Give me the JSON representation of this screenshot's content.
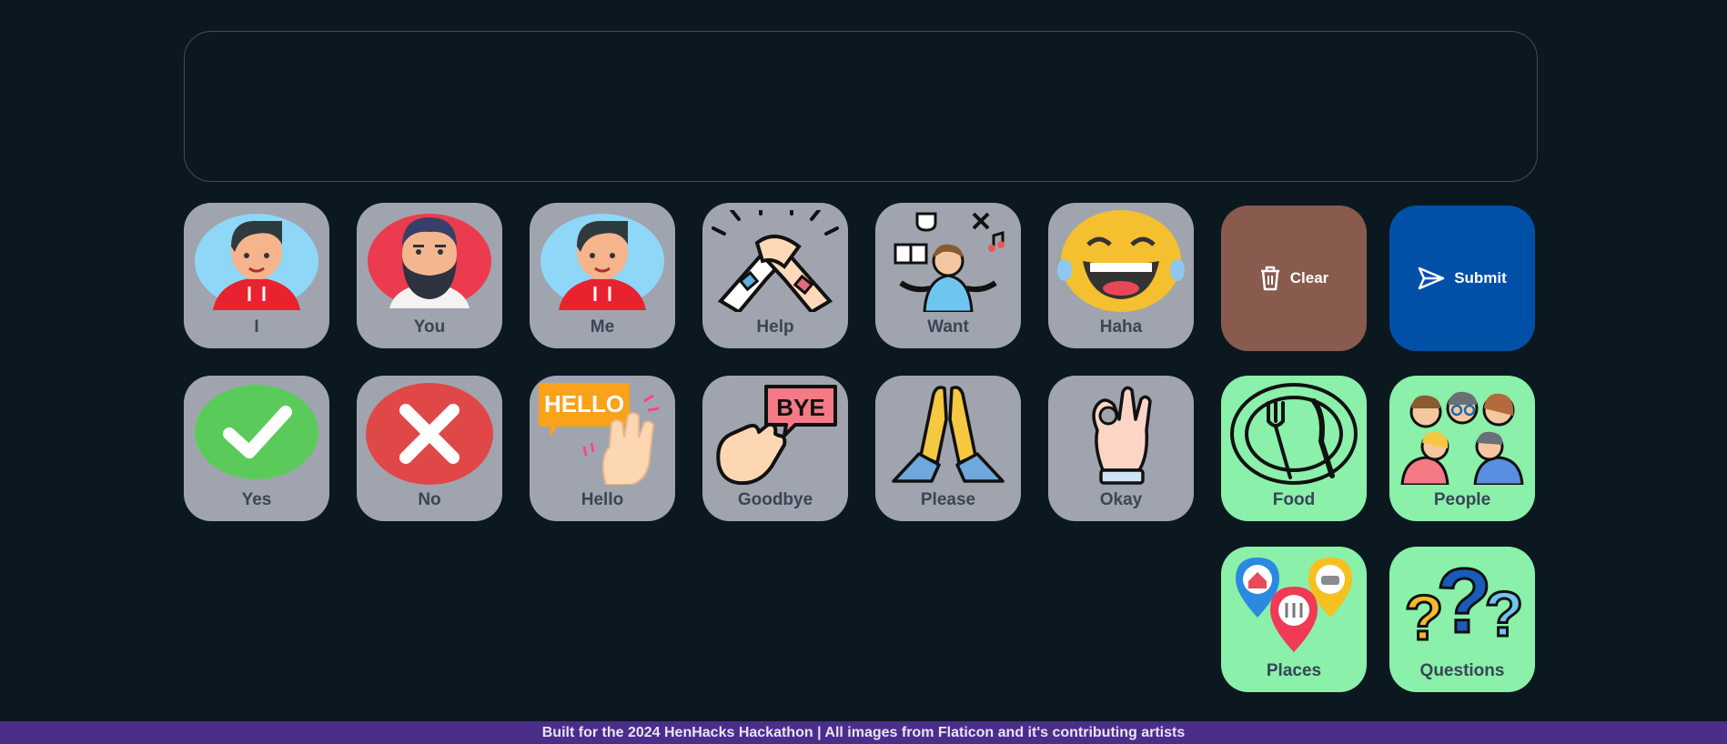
{
  "sentence": {
    "text": ""
  },
  "tiles": {
    "i": "I",
    "you": "You",
    "me": "Me",
    "help": "Help",
    "want": "Want",
    "haha": "Haha",
    "yes": "Yes",
    "no": "No",
    "hello": "Hello",
    "goodbye": "Goodbye",
    "please": "Please",
    "okay": "Okay"
  },
  "categories": {
    "food": "Food",
    "people": "People",
    "places": "Places",
    "questions": "Questions"
  },
  "actions": {
    "clear_label": "Clear",
    "submit_label": "Submit"
  },
  "image_text": {
    "hello_bubble": "HELLO",
    "bye_bubble": "BYE"
  },
  "footer": {
    "text": "Built for the 2024 HenHacks Hackathon | All images from Flaticon  and it's contributing artists"
  },
  "colors": {
    "background": "#0c1820",
    "word_tile": "#a0a4ae",
    "category_tile": "#8af0aa",
    "clear_button": "#885b4e",
    "submit_button": "#0050a8",
    "footer_bar": "#4b2d8a"
  },
  "icons": [
    "trash-icon",
    "send-icon"
  ]
}
